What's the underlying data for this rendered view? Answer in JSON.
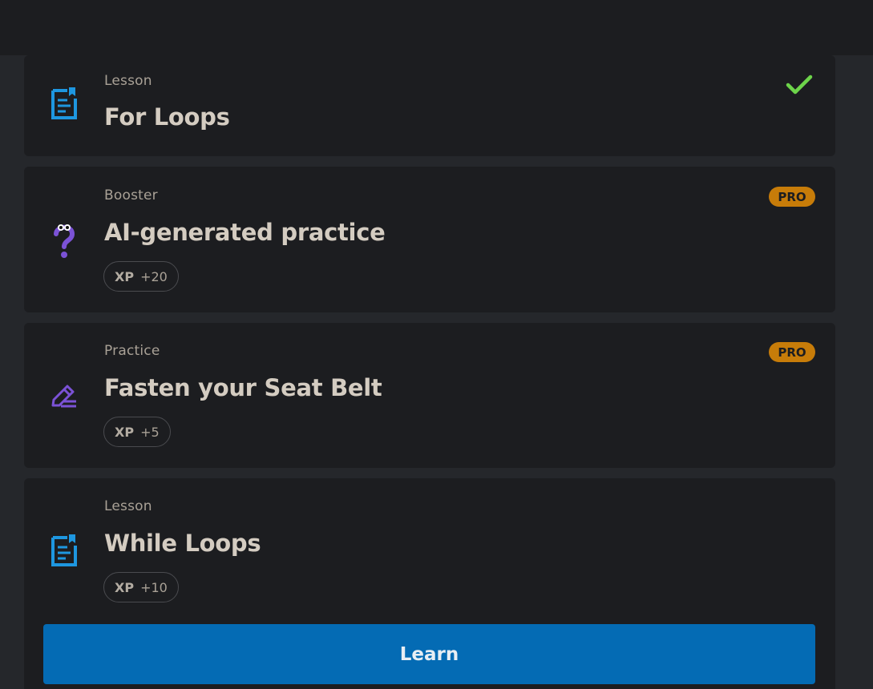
{
  "items": [
    {
      "kind": "Lesson",
      "title": "For Loops",
      "icon": "lesson-document-icon",
      "completed": true
    },
    {
      "kind": "Booster",
      "title": "AI-generated practice",
      "icon": "question-mascot-icon",
      "badge": "PRO",
      "xp_label": "XP",
      "xp_value": "+20"
    },
    {
      "kind": "Practice",
      "title": "Fasten your Seat Belt",
      "icon": "pencil-edit-icon",
      "badge": "PRO",
      "xp_label": "XP",
      "xp_value": "+5"
    },
    {
      "kind": "Lesson",
      "title": "While Loops",
      "icon": "lesson-document-icon",
      "xp_label": "XP",
      "xp_value": "+10"
    }
  ],
  "learn_button": "Learn",
  "colors": {
    "background": "#25272b",
    "card": "#1c1d20",
    "primary": "#046bb4",
    "pro_badge": "#c77c09",
    "check": "#6dd44a",
    "lesson_icon": "#1e97e0",
    "practice_icon": "#7b52d6"
  }
}
